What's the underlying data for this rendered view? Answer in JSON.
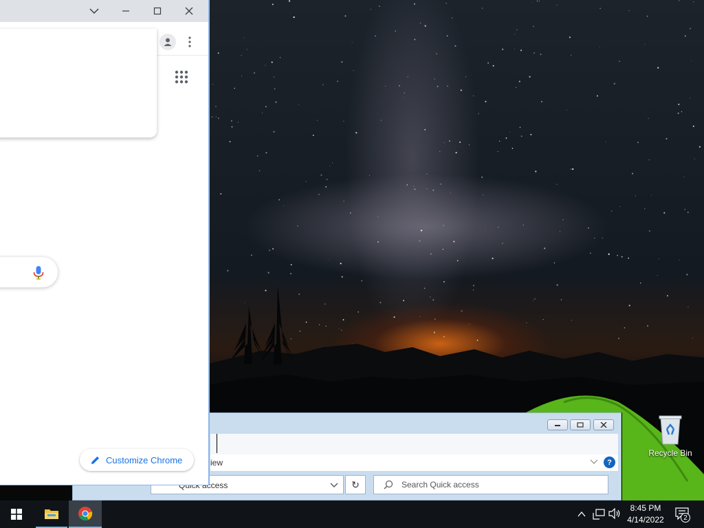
{
  "chrome": {
    "customize_label": "Customize Chrome"
  },
  "explorer": {
    "view_label": "iew",
    "address_value": "Quick access",
    "search_placeholder": "Search Quick access",
    "help_label": "?"
  },
  "desktop": {
    "recycle_bin_label": "Recycle Bin"
  },
  "taskbar": {
    "time": "8:45 PM",
    "date": "4/14/2022",
    "notification_count": "2"
  }
}
